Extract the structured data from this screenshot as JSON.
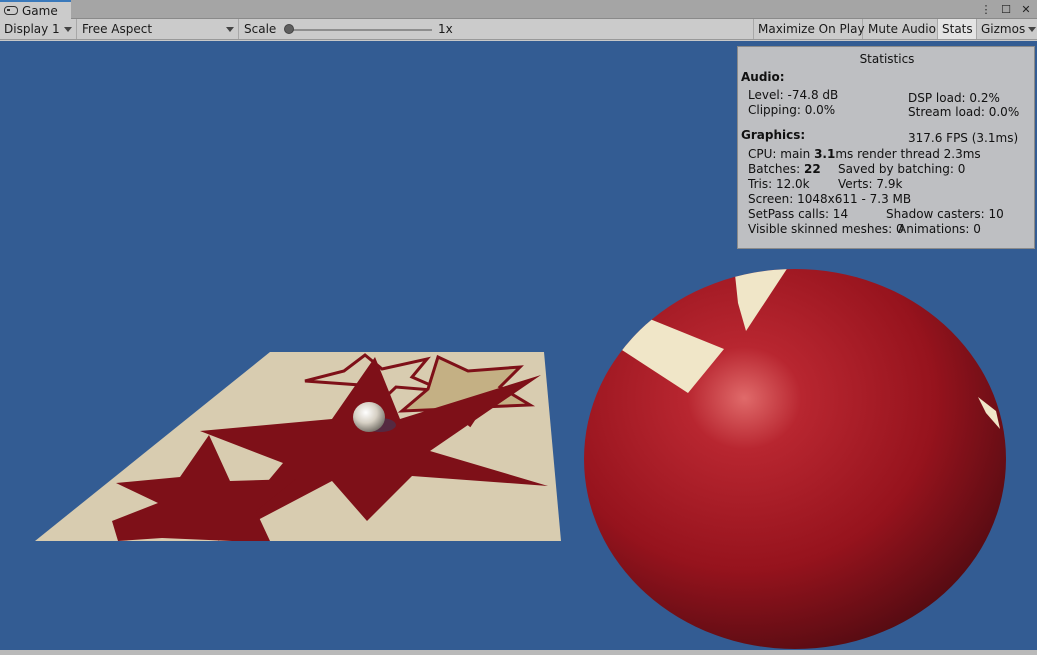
{
  "window": {
    "tab_label": "Game",
    "tab_icon": "gamepad-icon",
    "menu_icon": "⋮",
    "maximize_icon": "☐",
    "close_icon": "✕"
  },
  "toolbar": {
    "display": "Display 1",
    "aspect": "Free Aspect",
    "scale_label": "Scale",
    "scale_value": "1x",
    "scale_level": 0,
    "maximize_on_play": "Maximize On Play",
    "mute_audio": "Mute Audio",
    "stats": "Stats",
    "gizmos": "Gizmos"
  },
  "colors": {
    "background": "#335c93",
    "plane": "#d8ccb0",
    "star": "#7e1018",
    "sphere": "#a3141f",
    "stripe": "#f0e6c8"
  },
  "stats": {
    "title": "Statistics",
    "audio_heading": "Audio:",
    "level": "Level: -74.8 dB",
    "dsp_load": "DSP load: 0.2%",
    "clipping": "Clipping: 0.0%",
    "stream_load": "Stream load: 0.0%",
    "graphics_heading": "Graphics:",
    "fps": "317.6 FPS (3.1ms)",
    "cpu_prefix": "CPU: main ",
    "cpu_main": "3.1",
    "cpu_suffix": "ms  render thread 2.3ms",
    "batches_prefix": "Batches: ",
    "batches_value": "22",
    "saved_by_batching": "Saved by batching: 0",
    "tris": "Tris: 12.0k",
    "verts": "Verts: 7.9k",
    "screen": "Screen: 1048x611 - 7.3 MB",
    "setpass": "SetPass calls: 14",
    "shadow_casters": "Shadow casters: 10",
    "skinned_meshes": "Visible skinned meshes: 0",
    "animations": "Animations: 0"
  }
}
